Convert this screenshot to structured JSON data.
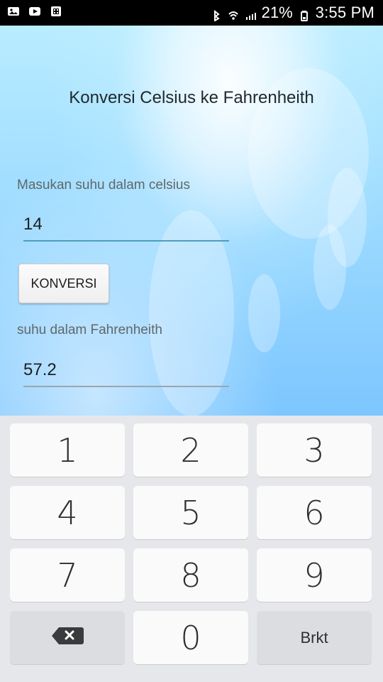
{
  "status_bar": {
    "battery": "21%",
    "time": "3:55 PM"
  },
  "screen": {
    "title": "Konversi Celsius ke Fahrenheith",
    "celsius_label": "Masukan suhu dalam celsius",
    "celsius_value": "14",
    "convert_button": "KONVERSI",
    "fahrenheit_label": "suhu dalam Fahrenheith",
    "fahrenheit_value": "57.2"
  },
  "keyboard": {
    "keys": [
      "1",
      "2",
      "3",
      "4",
      "5",
      "6",
      "7",
      "8",
      "9",
      "0"
    ],
    "action_key": "Brkt",
    "icons": {
      "backspace": "backspace-icon"
    }
  },
  "colors": {
    "accent_line": "#4c9ebd",
    "keyboard_bg": "#e6e7ea",
    "key_bg": "#fafafa"
  }
}
